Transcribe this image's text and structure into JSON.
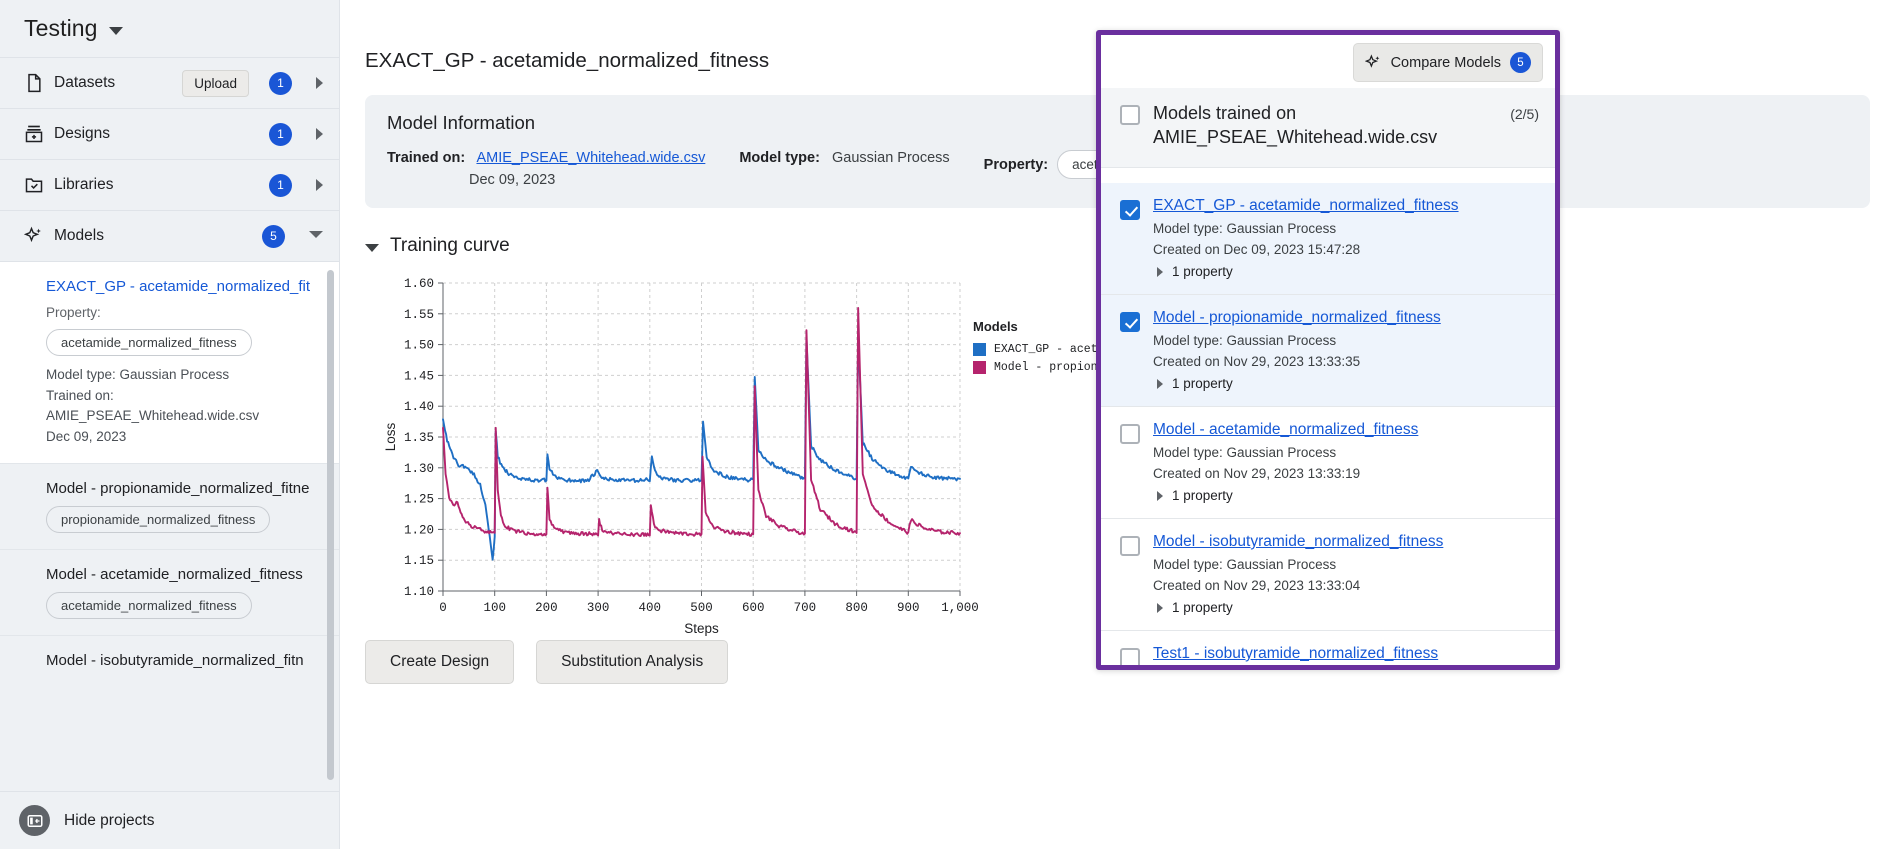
{
  "sidebar": {
    "project_title": "Testing",
    "nav": [
      {
        "label": "Datasets",
        "icon": "file-icon",
        "badge": "1",
        "button": "Upload"
      },
      {
        "label": "Designs",
        "icon": "designs-icon",
        "badge": "1"
      },
      {
        "label": "Libraries",
        "icon": "folder-check-icon",
        "badge": "1"
      },
      {
        "label": "Models",
        "icon": "sparkle-icon",
        "badge": "5"
      }
    ],
    "models": [
      {
        "name": "EXACT_GP - acetamide_normalized_fit",
        "property_label": "Property:",
        "property": "acetamide_normalized_fitness",
        "model_type": "Model type: Gaussian Process",
        "trained_on_label": "Trained on:",
        "trained_on": "AMIE_PSEAE_Whitehead.wide.csv",
        "date": "Dec 09, 2023"
      },
      {
        "name": "Model - propionamide_normalized_fitne",
        "property": "propionamide_normalized_fitness"
      },
      {
        "name": "Model - acetamide_normalized_fitness",
        "property": "acetamide_normalized_fitness"
      },
      {
        "name": "Model - isobutyramide_normalized_fitn",
        "property": ""
      }
    ],
    "hide_projects": "Hide projects"
  },
  "main": {
    "page_title": "EXACT_GP - acetamide_normalized_fitness",
    "model_information": {
      "heading": "Model Information",
      "trained_on_label": "Trained on:",
      "trained_on_file": "AMIE_PSEAE_Whitehead.wide.csv",
      "trained_on_date": "Dec 09, 2023",
      "model_type_label": "Model type:",
      "model_type_value": "Gaussian Process",
      "property_label": "Property:",
      "property_value": "acetamide_no"
    },
    "training_curve_heading": "Training curve",
    "buttons": {
      "create_design": "Create Design",
      "substitution_analysis": "Substitution Analysis"
    }
  },
  "chart_data": {
    "type": "line",
    "title": "",
    "xlabel": "Steps",
    "ylabel": "Loss",
    "xlim": [
      0,
      1000
    ],
    "ylim": [
      1.1,
      1.6
    ],
    "xticks": [
      "0",
      "100",
      "200",
      "300",
      "400",
      "500",
      "600",
      "700",
      "800",
      "900",
      "1,000"
    ],
    "yticks": [
      "1.10",
      "1.15",
      "1.20",
      "1.25",
      "1.30",
      "1.35",
      "1.40",
      "1.45",
      "1.50",
      "1.55",
      "1.60"
    ],
    "grid": true,
    "legend_title": "Models",
    "legend_position": "right",
    "series": [
      {
        "name": "EXACT_GP - acet",
        "color": "#1f6fc4",
        "points": [
          [
            0,
            1.38
          ],
          [
            8,
            1.345
          ],
          [
            18,
            1.32
          ],
          [
            30,
            1.305
          ],
          [
            45,
            1.3
          ],
          [
            60,
            1.29
          ],
          [
            72,
            1.272
          ],
          [
            82,
            1.24
          ],
          [
            90,
            1.19
          ],
          [
            96,
            1.148
          ],
          [
            100,
            1.188
          ],
          [
            102,
            1.36
          ],
          [
            106,
            1.318
          ],
          [
            115,
            1.3
          ],
          [
            125,
            1.292
          ],
          [
            140,
            1.286
          ],
          [
            160,
            1.281
          ],
          [
            185,
            1.279
          ],
          [
            200,
            1.28
          ],
          [
            202,
            1.32
          ],
          [
            206,
            1.298
          ],
          [
            215,
            1.286
          ],
          [
            240,
            1.28
          ],
          [
            280,
            1.279
          ],
          [
            298,
            1.294
          ],
          [
            305,
            1.284
          ],
          [
            330,
            1.28
          ],
          [
            380,
            1.279
          ],
          [
            400,
            1.281
          ],
          [
            404,
            1.317
          ],
          [
            410,
            1.295
          ],
          [
            420,
            1.284
          ],
          [
            450,
            1.28
          ],
          [
            490,
            1.279
          ],
          [
            500,
            1.281
          ],
          [
            503,
            1.375
          ],
          [
            510,
            1.318
          ],
          [
            520,
            1.298
          ],
          [
            540,
            1.288
          ],
          [
            560,
            1.283
          ],
          [
            590,
            1.28
          ],
          [
            600,
            1.281
          ],
          [
            603,
            1.448
          ],
          [
            610,
            1.33
          ],
          [
            625,
            1.312
          ],
          [
            650,
            1.3
          ],
          [
            670,
            1.292
          ],
          [
            690,
            1.285
          ],
          [
            700,
            1.282
          ],
          [
            703,
            1.51
          ],
          [
            712,
            1.335
          ],
          [
            730,
            1.312
          ],
          [
            755,
            1.298
          ],
          [
            780,
            1.288
          ],
          [
            800,
            1.282
          ],
          [
            803,
            1.513
          ],
          [
            812,
            1.34
          ],
          [
            830,
            1.315
          ],
          [
            860,
            1.295
          ],
          [
            890,
            1.285
          ],
          [
            900,
            1.282
          ],
          [
            905,
            1.3
          ],
          [
            930,
            1.288
          ],
          [
            960,
            1.283
          ],
          [
            1000,
            1.282
          ]
        ]
      },
      {
        "name": "Model - propion",
        "color": "#b5246d",
        "points": [
          [
            0,
            1.365
          ],
          [
            5,
            1.29
          ],
          [
            12,
            1.248
          ],
          [
            20,
            1.24
          ],
          [
            28,
            1.243
          ],
          [
            34,
            1.226
          ],
          [
            42,
            1.214
          ],
          [
            55,
            1.205
          ],
          [
            70,
            1.2
          ],
          [
            85,
            1.196
          ],
          [
            100,
            1.194
          ],
          [
            102,
            1.365
          ],
          [
            106,
            1.262
          ],
          [
            112,
            1.222
          ],
          [
            120,
            1.205
          ],
          [
            135,
            1.198
          ],
          [
            160,
            1.194
          ],
          [
            190,
            1.192
          ],
          [
            200,
            1.192
          ],
          [
            202,
            1.268
          ],
          [
            206,
            1.218
          ],
          [
            215,
            1.202
          ],
          [
            235,
            1.196
          ],
          [
            270,
            1.193
          ],
          [
            300,
            1.192
          ],
          [
            302,
            1.214
          ],
          [
            308,
            1.2
          ],
          [
            320,
            1.195
          ],
          [
            360,
            1.192
          ],
          [
            400,
            1.192
          ],
          [
            402,
            1.24
          ],
          [
            408,
            1.206
          ],
          [
            420,
            1.198
          ],
          [
            450,
            1.194
          ],
          [
            490,
            1.192
          ],
          [
            500,
            1.192
          ],
          [
            502,
            1.318
          ],
          [
            508,
            1.23
          ],
          [
            520,
            1.206
          ],
          [
            545,
            1.197
          ],
          [
            580,
            1.193
          ],
          [
            600,
            1.192
          ],
          [
            603,
            1.432
          ],
          [
            610,
            1.262
          ],
          [
            625,
            1.222
          ],
          [
            650,
            1.205
          ],
          [
            680,
            1.197
          ],
          [
            700,
            1.193
          ],
          [
            703,
            1.523
          ],
          [
            712,
            1.28
          ],
          [
            730,
            1.232
          ],
          [
            760,
            1.208
          ],
          [
            790,
            1.198
          ],
          [
            800,
            1.194
          ],
          [
            803,
            1.56
          ],
          [
            812,
            1.29
          ],
          [
            830,
            1.238
          ],
          [
            865,
            1.21
          ],
          [
            890,
            1.199
          ],
          [
            900,
            1.195
          ],
          [
            905,
            1.215
          ],
          [
            930,
            1.202
          ],
          [
            960,
            1.196
          ],
          [
            1000,
            1.194
          ]
        ]
      }
    ]
  },
  "compare_panel": {
    "button_label": "Compare Models",
    "button_badge": "5",
    "dataset_group_title": "Models trained on AMIE_PSEAE_Whitehead.wide.csv",
    "selected_count": "(2/5)",
    "group_checked": false,
    "models": [
      {
        "name": "EXACT_GP - acetamide_normalized_fitness",
        "model_type": "Model type: Gaussian Process",
        "created": "Created on Dec 09, 2023 15:47:28",
        "property_count": "1 property",
        "checked": true
      },
      {
        "name": "Model - propionamide_normalized_fitness",
        "model_type": "Model type: Gaussian Process",
        "created": "Created on Nov 29, 2023 13:33:35",
        "property_count": "1 property",
        "checked": true
      },
      {
        "name": "Model - acetamide_normalized_fitness",
        "model_type": "Model type: Gaussian Process",
        "created": "Created on Nov 29, 2023 13:33:19",
        "property_count": "1 property",
        "checked": false
      },
      {
        "name": "Model - isobutyramide_normalized_fitness",
        "model_type": "Model type: Gaussian Process",
        "created": "Created on Nov 29, 2023 13:33:04",
        "property_count": "1 property",
        "checked": false
      },
      {
        "name": "Test1 - isobutyramide_normalized_fitness",
        "model_type": "",
        "created": "",
        "property_count": "",
        "checked": false
      }
    ]
  },
  "colors": {
    "accent_blue": "#1558d6",
    "badge_blue": "#1a56d6",
    "panel_purple": "#6a2f9e",
    "series_blue": "#1f6fc4",
    "series_magenta": "#b5246d"
  }
}
